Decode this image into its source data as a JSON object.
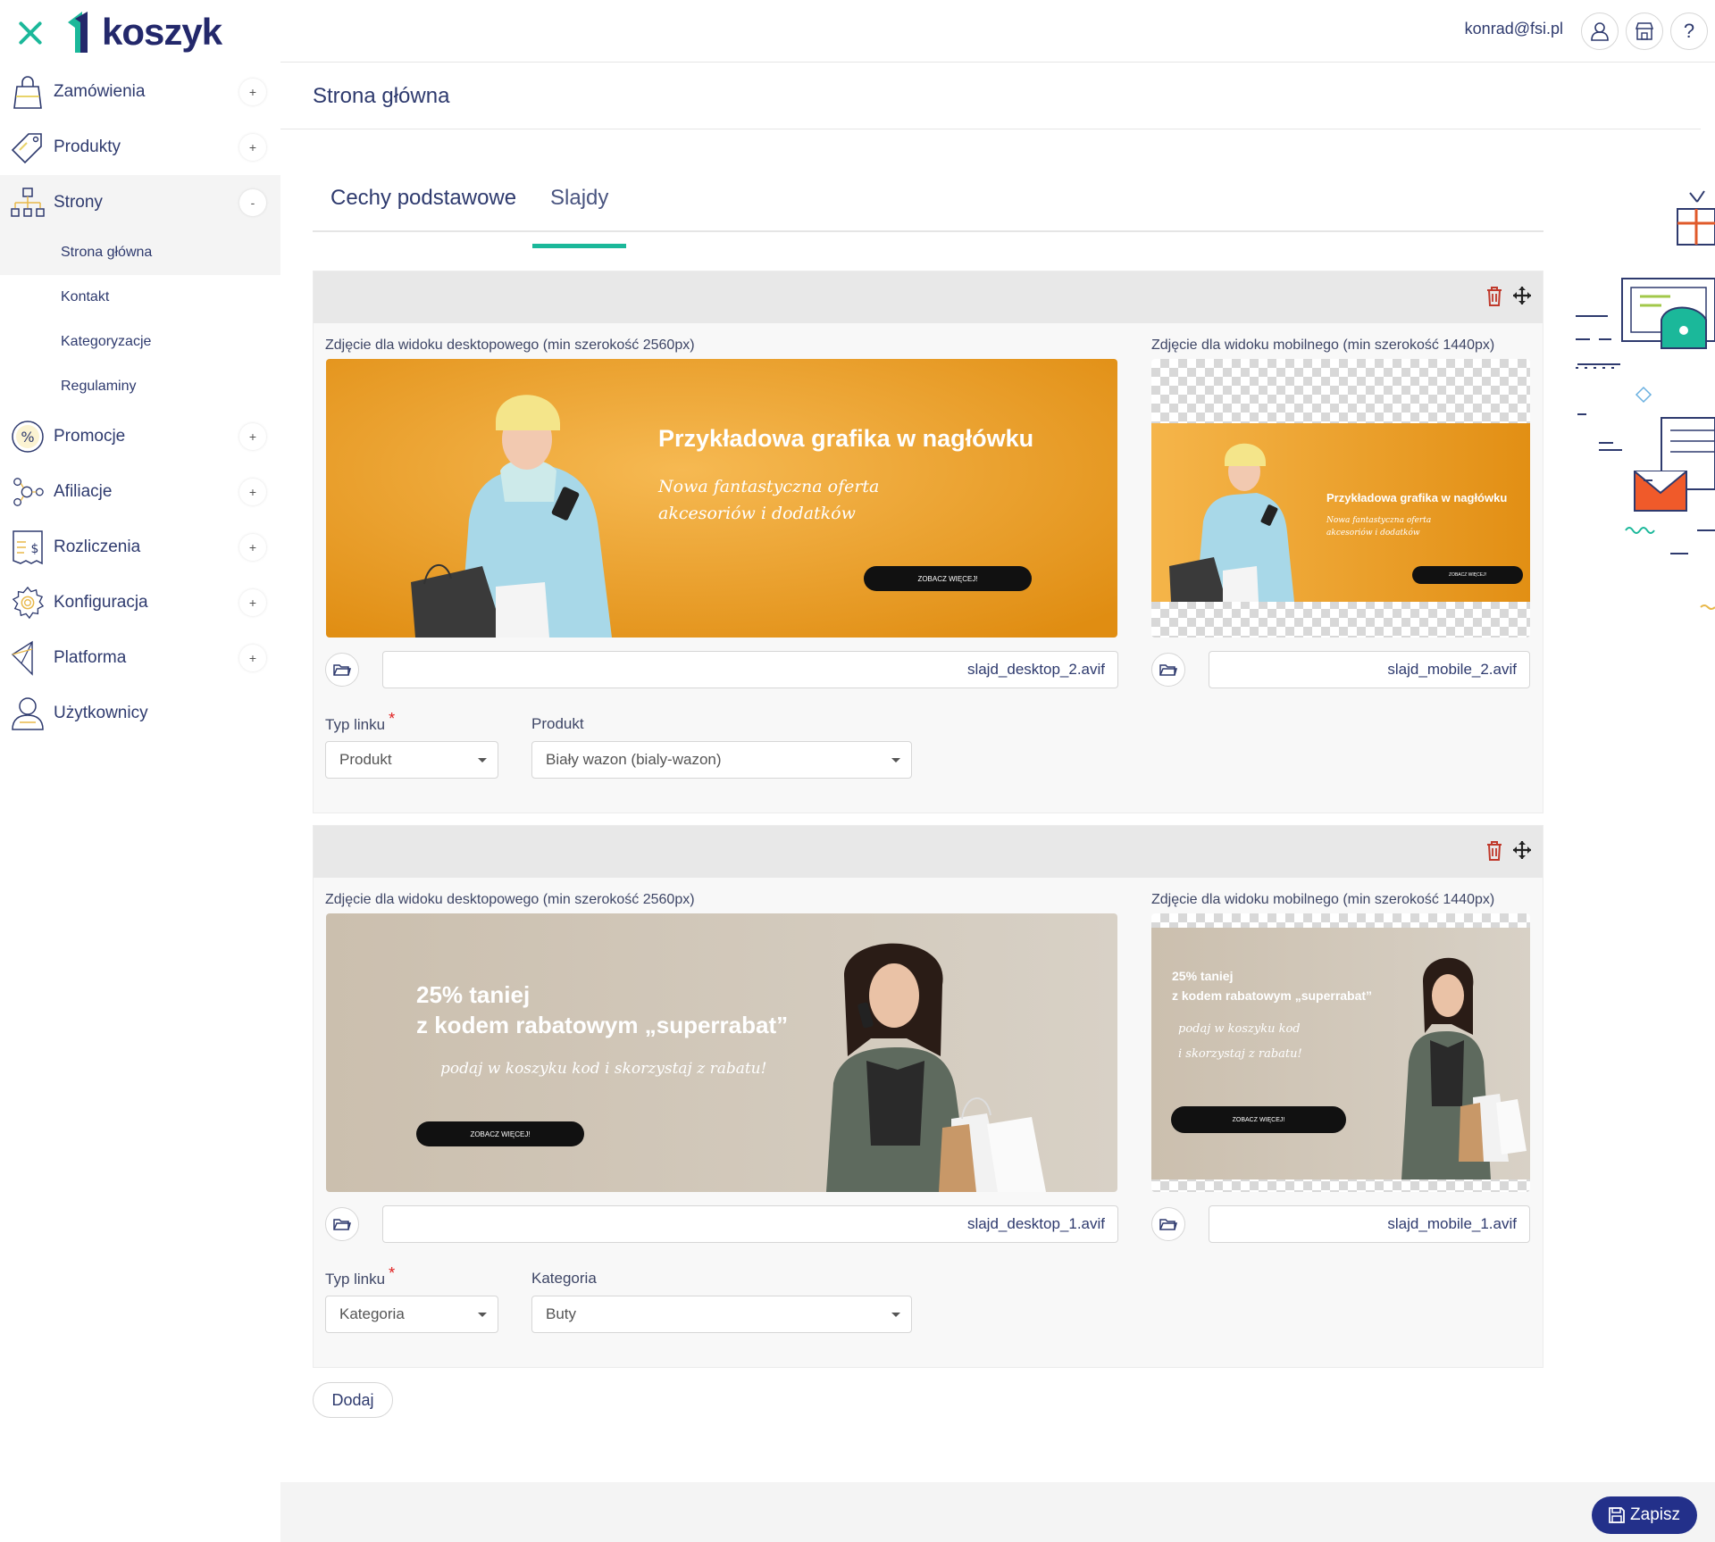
{
  "brand": {
    "logo_text": "koszyk"
  },
  "sidebar": {
    "items": [
      {
        "label": "Zamówienia",
        "toggle": "+"
      },
      {
        "label": "Produkty",
        "toggle": "+"
      },
      {
        "label": "Strony",
        "toggle": "-"
      },
      {
        "label": "Promocje",
        "toggle": "+"
      },
      {
        "label": "Afiliacje",
        "toggle": "+"
      },
      {
        "label": "Rozliczenia",
        "toggle": "+"
      },
      {
        "label": "Konfiguracja",
        "toggle": "+"
      },
      {
        "label": "Platforma",
        "toggle": "+"
      },
      {
        "label": "Użytkownicy"
      }
    ],
    "strony_sub": [
      "Strona główna",
      "Kontakt",
      "Kategoryzacje",
      "Regulaminy"
    ]
  },
  "header": {
    "email": "konrad@fsi.pl",
    "help": "?"
  },
  "page": {
    "title": "Strona główna"
  },
  "tabs": [
    "Cechy podstawowe",
    "Slajdy"
  ],
  "slides": [
    {
      "desktop_label": "Zdjęcie dla widoku desktopowego (min szerokość 2560px)",
      "mobile_label": "Zdjęcie dla widoku mobilnego (min szerokość 1440px)",
      "desktop_file": "slajd_desktop_2.avif",
      "mobile_file": "slajd_mobile_2.avif",
      "link_type_label": "Typ linku",
      "link_type_value": "Produkt",
      "target_label": "Produkt",
      "target_value": "Biały wazon (bialy-wazon)",
      "banner": {
        "heading": "Przykładowa grafika w nagłówku",
        "script_line1": "Nowa fantastyczna oferta",
        "script_line2": "akcesoriów i dodatków",
        "button": "ZOBACZ WIĘCEJ!"
      }
    },
    {
      "desktop_label": "Zdjęcie dla widoku desktopowego (min szerokość 2560px)",
      "mobile_label": "Zdjęcie dla widoku mobilnego (min szerokość 1440px)",
      "desktop_file": "slajd_desktop_1.avif",
      "mobile_file": "slajd_mobile_1.avif",
      "link_type_label": "Typ linku",
      "link_type_value": "Kategoria",
      "target_label": "Kategoria",
      "target_value": "Buty",
      "banner": {
        "heading1": "25% taniej",
        "heading2": "z kodem rabatowym „superrabat”",
        "script": "podaj w koszyku kod i skorzystaj z rabatu!",
        "script_m1": "podaj w koszyku kod",
        "script_m2": "i skorzystaj z rabatu!",
        "button": "ZOBACZ WIĘCEJ!"
      }
    }
  ],
  "actions": {
    "add": "Dodaj",
    "save": "Zapisz"
  },
  "colors": {
    "accent": "#1bb89a",
    "brand": "#23286b",
    "save": "#23308a",
    "orange": "#f0a73a",
    "beige": "#cdc3b3"
  }
}
